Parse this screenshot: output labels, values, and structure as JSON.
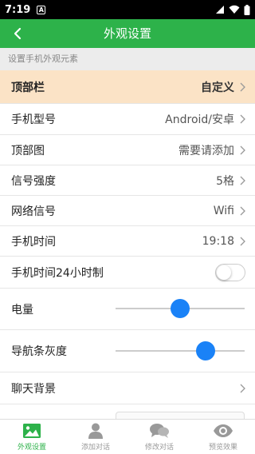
{
  "status_bar": {
    "time": "7:19",
    "notification_letter": "A"
  },
  "header": {
    "title": "外观设置"
  },
  "section_hint": "设置手机外观元素",
  "settings": {
    "top_bar": {
      "label": "顶部栏",
      "value": "自定义"
    },
    "phone_model": {
      "label": "手机型号",
      "value": "Android/安卓"
    },
    "top_image": {
      "label": "顶部图",
      "value": "需要请添加"
    },
    "signal_strength": {
      "label": "信号强度",
      "value": "5格"
    },
    "network_signal": {
      "label": "网络信号",
      "value": "Wifi"
    },
    "phone_time": {
      "label": "手机时间",
      "value": "19:18"
    },
    "time_24h": {
      "label": "手机时间24小时制",
      "enabled": false
    },
    "battery": {
      "label": "电量",
      "level": 0.5
    },
    "nav_bar_gray": {
      "label": "导航条灰度",
      "level": 0.7
    },
    "chat_background": {
      "label": "聊天背景"
    }
  },
  "bottom_tabs": [
    {
      "label": "外观设置",
      "icon": "image-icon",
      "active": true
    },
    {
      "label": "添加对话",
      "icon": "person-icon",
      "active": false
    },
    {
      "label": "修改对话",
      "icon": "chat-bubbles-icon",
      "active": false
    },
    {
      "label": "预览效果",
      "icon": "eye-icon",
      "active": false
    }
  ],
  "colors": {
    "accent": "#2db24a",
    "highlight_row": "#fbe3c6",
    "slider": "#1a82f7"
  }
}
